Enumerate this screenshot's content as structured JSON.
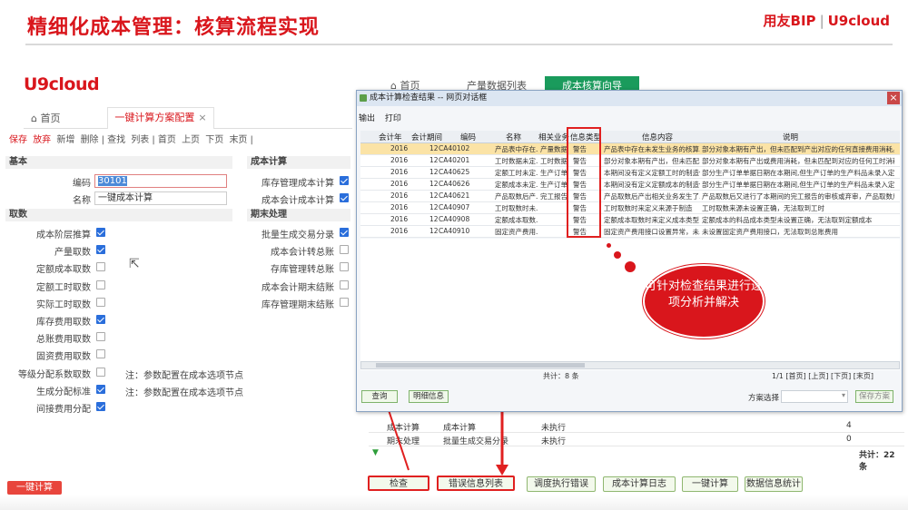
{
  "slide": {
    "title": "精细化成本管理：核算流程实现",
    "brand_left": "用友BIP",
    "brand_right": "U9cloud"
  },
  "left_panel": {
    "logo": "U9cloud",
    "home_label": "首页",
    "tab_label": "一键计算方案配置",
    "tab_close": "×",
    "toolbar": [
      "保存",
      "放弃",
      "新增",
      "删除",
      "查找",
      "列表",
      "首页",
      "上页",
      "下页",
      "末页"
    ],
    "sections": {
      "basic": "基本",
      "fetch": "取数",
      "cost_calc": "成本计算",
      "period_end": "期末处理"
    },
    "basic": {
      "code_label": "编码",
      "code_value": "30101",
      "name_label": "名称",
      "name_value": "一键成本计算"
    },
    "fetch_items": [
      {
        "label": "成本阶层推算",
        "checked": true
      },
      {
        "label": "产量取数",
        "checked": true
      },
      {
        "label": "定额成本取数",
        "checked": false
      },
      {
        "label": "定额工时取数",
        "checked": false
      },
      {
        "label": "实际工时取数",
        "checked": false
      },
      {
        "label": "库存费用取数",
        "checked": true
      },
      {
        "label": "总账费用取数",
        "checked": false
      },
      {
        "label": "固资费用取数",
        "checked": false
      },
      {
        "label": "等级分配系数取数",
        "checked": false
      },
      {
        "label": "生成分配标准",
        "checked": true
      },
      {
        "label": "间接费用分配",
        "checked": true
      }
    ],
    "notes": [
      "注：参数配置在成本选项节点",
      "注：参数配置在成本选项节点"
    ],
    "cost_items": [
      {
        "label": "库存管理成本计算",
        "checked": true
      },
      {
        "label": "成本会计成本计算",
        "checked": true
      }
    ],
    "period_items": [
      {
        "label": "批量生成交易分录",
        "checked": true
      },
      {
        "label": "成本会计转总账",
        "checked": false
      },
      {
        "label": "存库管理转总账",
        "checked": false
      },
      {
        "label": "成本会计期末结账",
        "checked": false
      },
      {
        "label": "库存管理期末结账",
        "checked": false
      }
    ],
    "bottom_button": "一键计算"
  },
  "right_window": {
    "home_label": "首页",
    "tab1": "产量数据列表",
    "tab2": "成本核算向导",
    "back_rows": [
      {
        "c1": "成本计算",
        "c2": "成本计算",
        "c3": "未执行",
        "c4": "4"
      },
      {
        "c1": "期末处理",
        "c2": "批量生成交易分录",
        "c3": "未执行",
        "c4": "0"
      }
    ],
    "total": "共计：22 条",
    "buttons": [
      "检查",
      "错误信息列表",
      "调度执行错误",
      "成本计算日志",
      "一键计算",
      "数据信息统计"
    ]
  },
  "dialog": {
    "title": "成本计算检查结果 -- 网页对话框",
    "menu": [
      "输出",
      "打印"
    ],
    "columns": [
      "会计年",
      "会计期间",
      "编码",
      "名称",
      "相关业务",
      "信息类型",
      "信息内容",
      "说明"
    ],
    "rows": [
      {
        "year": "2016",
        "period": "12",
        "code": "CA40102",
        "name": "产品表中存在...",
        "biz": "产量数据",
        "type": "警告",
        "content": "产品表中存在未发生业务的核算...",
        "desc": "部分对象本期有产出，但未匹配到产出对应的任何直接费用消耗。原..."
      },
      {
        "year": "2016",
        "period": "12",
        "code": "CA40201",
        "name": "工时数据未定...",
        "biz": "工时数据",
        "type": "警告",
        "content": "部分对象本期有产出，但未匹配...",
        "desc": "部分对象本期有产出或费用消耗，但未匹配到对应的任何工时消耗,..."
      },
      {
        "year": "2016",
        "period": "12",
        "code": "CA40625",
        "name": "定额工时未定...",
        "biz": "生产订单",
        "type": "警告",
        "content": "本期间没有定义定额工时的制造件",
        "desc": "部分生产订单单据日期在本期间,但生产订单的生产料品未录入定额..."
      },
      {
        "year": "2016",
        "period": "12",
        "code": "CA40626",
        "name": "定额成本未定...",
        "biz": "生产订单",
        "type": "警告",
        "content": "本期间没有定义定额成本的制造件",
        "desc": "部分生产订单单据日期在本期间,但生产订单的生产料品未录入定额..."
      },
      {
        "year": "2016",
        "period": "12",
        "code": "CA40621",
        "name": "产品取数后产...",
        "biz": "完工报告",
        "type": "警告",
        "content": "产品取数后产出相关业务发生了...",
        "desc": "产品取数后又进行了本期间的完工报告的审核或弃审，产品取数后又..."
      },
      {
        "year": "2016",
        "period": "12",
        "code": "CA40907",
        "name": "工时取数时未...",
        "biz": "",
        "type": "警告",
        "content": "工时取数时来定义来源于制造",
        "desc": "工时取数来源未设置正确，无法取到工时"
      },
      {
        "year": "2016",
        "period": "12",
        "code": "CA40908",
        "name": "定额成本取数...",
        "biz": "",
        "type": "警告",
        "content": "定额成本取数时来定义成本类型",
        "desc": "定额成本的料品成本类型未设置正确，无法取到定额成本"
      },
      {
        "year": "2016",
        "period": "12",
        "code": "CA40910",
        "name": "固定资产费用...",
        "biz": "",
        "type": "警告",
        "content": "固定资产费用接口设置异常，未...",
        "desc": "未设置固定资产费用接口，无法取到总账费用"
      }
    ],
    "status_total": "共计：8 条",
    "pager": "1/1 [首页] [上页] [下页] [末页]",
    "query_btn": "查询",
    "detail_btn": "明细信息",
    "scheme_label": "方案选择",
    "save_scheme_btn": "保存方案"
  },
  "bubble_text": "可针对检查结果进行逐项分析并解决"
}
